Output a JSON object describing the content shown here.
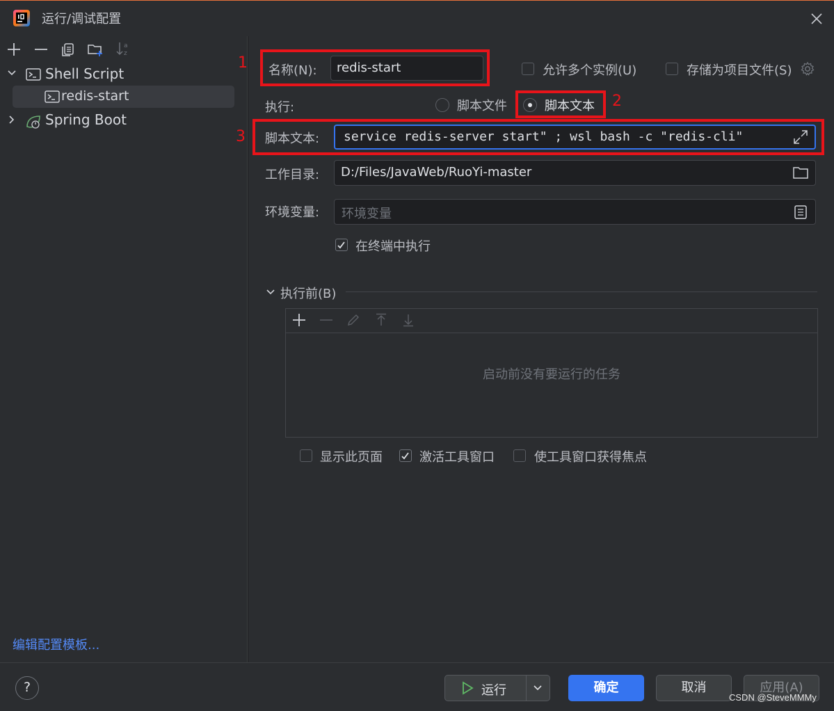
{
  "window": {
    "title": "运行/调试配置"
  },
  "left_toolbar": {
    "icons": [
      "add-icon",
      "remove-icon",
      "copy-icon",
      "new-folder-icon",
      "sort-icon"
    ]
  },
  "tree": {
    "groups": [
      {
        "label": "Shell Script",
        "icon": "terminal-icon",
        "expanded": true,
        "children": [
          {
            "label": "redis-start",
            "selected": true
          }
        ]
      },
      {
        "label": "Spring Boot",
        "icon": "spring-boot-icon",
        "expanded": false,
        "children": []
      }
    ]
  },
  "edit_templates_link": "编辑配置模板...",
  "form": {
    "name_label": "名称(N):",
    "name_value": "redis-start",
    "allow_multiple_label": "允许多个实例(U)",
    "store_as_file_label": "存储为项目文件(S)",
    "execute_label": "执行:",
    "radio_script_file": "脚本文件",
    "radio_script_text": "脚本文本",
    "selected_mode": "脚本文本",
    "script_text_label": "脚本文本:",
    "script_text_value": "service redis-server start\" ; wsl bash -c \"redis-cli\"",
    "workdir_label": "工作目录:",
    "workdir_value": "D:/Files/JavaWeb/RuoYi-master",
    "env_label": "环境变量:",
    "env_placeholder": "环境变量",
    "exec_in_terminal_label": "在终端中执行",
    "exec_in_terminal_checked": true
  },
  "before_launch": {
    "header": "执行前(B)",
    "toolbar_icons": [
      "add-icon",
      "remove-icon",
      "edit-icon",
      "move-up-icon",
      "move-down-icon"
    ],
    "empty_text": "启动前没有要运行的任务"
  },
  "options": {
    "show_page_label": "显示此页面",
    "show_page_checked": false,
    "activate_tool_window_label": "激活工具窗口",
    "activate_tool_window_checked": true,
    "focus_tool_window_label": "使工具窗口获得焦点",
    "focus_tool_window_checked": false
  },
  "annotations": [
    "1",
    "2",
    "3"
  ],
  "footer": {
    "help": "?",
    "run_label": "运行",
    "ok_label": "确定",
    "cancel_label": "取消",
    "apply_label": "应用(A)"
  },
  "watermark": "CSDN @SteveMMMy",
  "colors": {
    "accent": "#3574f0",
    "annotation_red": "#e8141a",
    "background": "#2b2d30"
  }
}
